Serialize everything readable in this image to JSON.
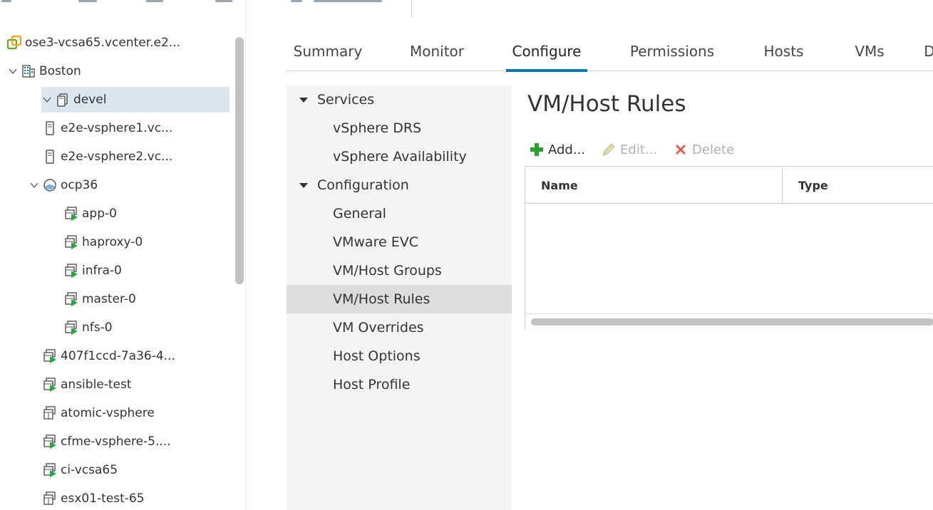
{
  "tree": {
    "items": [
      {
        "label": "ose3-vcsa65.vcenter.e2...",
        "icon": "vcenter-icon",
        "chevron": "none",
        "indent": 0
      },
      {
        "label": "Boston",
        "icon": "datacenter-icon",
        "chevron": "down",
        "indent": 0
      },
      {
        "label": "devel",
        "icon": "cluster-icon",
        "chevron": "down",
        "indent": 1,
        "selected": true
      },
      {
        "label": "e2e-vsphere1.vc...",
        "icon": "host-icon",
        "chevron": "none",
        "indent": 2
      },
      {
        "label": "e2e-vsphere2.vc...",
        "icon": "host-icon",
        "chevron": "none",
        "indent": 2
      },
      {
        "label": "ocp36",
        "icon": "resource-pool-icon",
        "chevron": "down",
        "indent": 2
      },
      {
        "label": "app-0",
        "icon": "vm-on-icon",
        "chevron": "none",
        "indent": 3
      },
      {
        "label": "haproxy-0",
        "icon": "vm-on-icon",
        "chevron": "none",
        "indent": 3
      },
      {
        "label": "infra-0",
        "icon": "vm-on-icon",
        "chevron": "none",
        "indent": 3
      },
      {
        "label": "master-0",
        "icon": "vm-on-icon",
        "chevron": "none",
        "indent": 3
      },
      {
        "label": "nfs-0",
        "icon": "vm-on-icon",
        "chevron": "none",
        "indent": 3
      },
      {
        "label": "407f1ccd-7a36-4...",
        "icon": "vm-on-icon",
        "chevron": "none",
        "indent": 2
      },
      {
        "label": "ansible-test",
        "icon": "vm-on-icon",
        "chevron": "none",
        "indent": 2
      },
      {
        "label": "atomic-vsphere",
        "icon": "vm-off-icon",
        "chevron": "none",
        "indent": 2
      },
      {
        "label": "cfme-vsphere-5....",
        "icon": "vm-on-icon",
        "chevron": "none",
        "indent": 2
      },
      {
        "label": "ci-vcsa65",
        "icon": "vm-on-icon",
        "chevron": "none",
        "indent": 2
      },
      {
        "label": "esx01-test-65",
        "icon": "vm-off-icon",
        "chevron": "none",
        "indent": 2
      }
    ]
  },
  "tabs": [
    {
      "label": "Summary"
    },
    {
      "label": "Monitor"
    },
    {
      "label": "Configure",
      "active": true
    },
    {
      "label": "Permissions"
    },
    {
      "label": "Hosts"
    },
    {
      "label": "VMs"
    },
    {
      "label": "D"
    }
  ],
  "nav": {
    "items": [
      {
        "label": "Services",
        "type": "section"
      },
      {
        "label": "vSphere DRS",
        "type": "leaf"
      },
      {
        "label": "vSphere Availability",
        "type": "leaf"
      },
      {
        "label": "Configuration",
        "type": "section"
      },
      {
        "label": "General",
        "type": "leaf"
      },
      {
        "label": "VMware EVC",
        "type": "leaf"
      },
      {
        "label": "VM/Host Groups",
        "type": "leaf"
      },
      {
        "label": "VM/Host Rules",
        "type": "leaf",
        "selected": true
      },
      {
        "label": "VM Overrides",
        "type": "leaf"
      },
      {
        "label": "Host Options",
        "type": "leaf"
      },
      {
        "label": "Host Profile",
        "type": "leaf"
      }
    ]
  },
  "content": {
    "title": "VM/Host Rules",
    "toolbar": {
      "add": "Add...",
      "edit": "Edit...",
      "delete": "Delete"
    },
    "grid": {
      "columns": [
        "Name",
        "Type"
      ]
    }
  },
  "colors": {
    "accent": "#0079b8",
    "add_green": "#2e9e2e",
    "delete_red": "#e05a4a",
    "vm_green": "#28a745",
    "selection": "#dae5ee"
  }
}
